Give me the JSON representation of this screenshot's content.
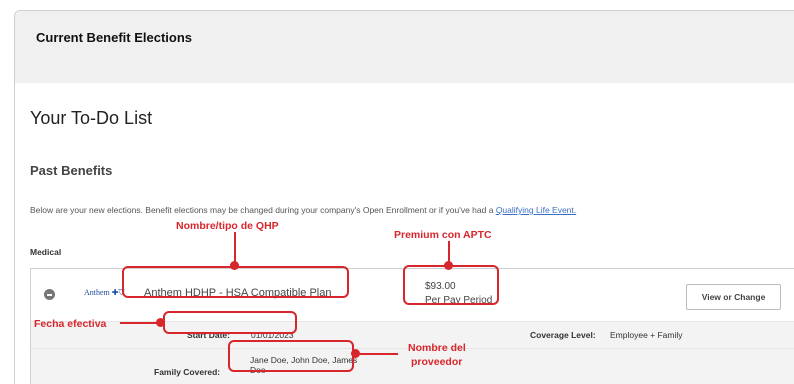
{
  "header": {
    "title": "Current Benefit Elections"
  },
  "todo": {
    "title": "Your To-Do List"
  },
  "past_benefits": {
    "title": "Past Benefits",
    "intro": "Below are your new elections. Benefit elections may be changed during your company's Open Enrollment or if you've had a ",
    "intro_link": "Qualifying Life Event."
  },
  "medical": {
    "label": "Medical",
    "carrier_logo": "Anthem",
    "plan_name": "Anthem HDHP - HSA Compatible Plan",
    "premium_amount": "$93.00",
    "premium_period": "Per Pay Period",
    "view_button": "View or Change",
    "start_label": "Start Date:",
    "start_value": "01/01/2023",
    "coverage_label": "Coverage Level:",
    "coverage_value": "Employee + Family",
    "family_label": "Family Covered:",
    "family_value": "Jane Doe, John Doe, James Doe"
  },
  "annotations": {
    "qhp": "Nombre/tipo de QHP",
    "premium": "Premium con APTC",
    "effective": "Fecha efectiva",
    "provider_line1": "Nombre del",
    "provider_line2": "proveedor",
    "color": "#d7262c"
  }
}
